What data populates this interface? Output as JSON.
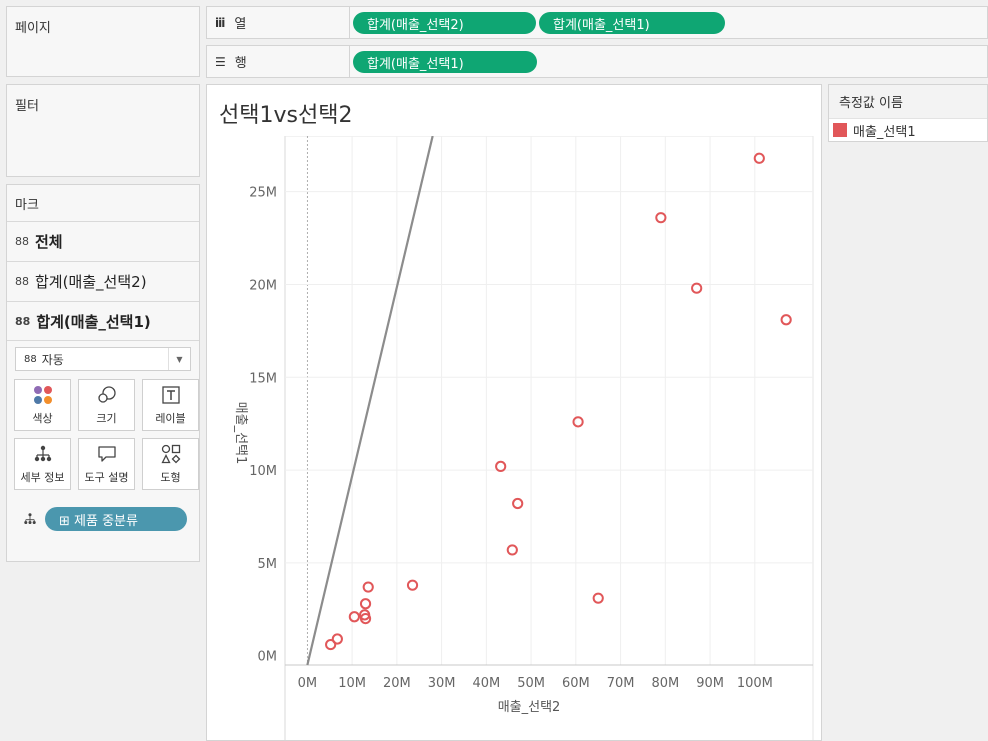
{
  "panels": {
    "pages_label": "페이지",
    "filters_label": "필터",
    "marks_label": "마크"
  },
  "shelves": {
    "columns": {
      "icon": "iii",
      "label": "열",
      "pills": [
        "합계(매출_선택2)",
        "합계(매출_선택1)"
      ]
    },
    "rows": {
      "icon": "☰",
      "label": "행",
      "pills": [
        "합계(매출_선택1)"
      ]
    }
  },
  "marks": {
    "cards": [
      {
        "label": "전체",
        "icon": "pill-group-icon"
      },
      {
        "label": "합계(매출_선택2)",
        "icon": "pill-group-icon"
      },
      {
        "label": "합계(매출_선택1)",
        "icon": "pill-group-icon"
      }
    ],
    "mark_type": "자동",
    "buttons": [
      {
        "label": "색상",
        "icon": "color-icon"
      },
      {
        "label": "크기",
        "icon": "size-icon"
      },
      {
        "label": "레이블",
        "icon": "label-icon"
      },
      {
        "label": "세부 정보",
        "icon": "detail-icon"
      },
      {
        "label": "도구 설명",
        "icon": "tooltip-icon"
      },
      {
        "label": "도형",
        "icon": "shape-icon"
      }
    ],
    "detail_pill": "⊞ 제품 중분류"
  },
  "legend": {
    "title": "측정값 이름",
    "items": [
      {
        "label": "매출_선택1",
        "color": "#e15759"
      }
    ]
  },
  "chart_data": {
    "type": "scatter",
    "title": "선택1vs선택2",
    "xlabel": "매출_선택2",
    "ylabel": "매출_선택1",
    "xlim": [
      -5,
      113
    ],
    "ylim": [
      -0.5,
      28
    ],
    "x_ticks": [
      0,
      10,
      20,
      30,
      40,
      50,
      60,
      70,
      80,
      90,
      100
    ],
    "x_tick_labels": [
      "0M",
      "10M",
      "20M",
      "30M",
      "40M",
      "50M",
      "60M",
      "70M",
      "80M",
      "90M",
      "100M"
    ],
    "y_ticks": [
      0,
      5,
      10,
      15,
      20,
      25
    ],
    "y_tick_labels": [
      "0M",
      "5M",
      "10M",
      "15M",
      "20M",
      "25M"
    ],
    "grid": true,
    "marker": "open-circle",
    "marker_color": "#e15759",
    "reference_line": {
      "type": "trend",
      "x": [
        0,
        28
      ],
      "y": [
        -0.5,
        28
      ]
    },
    "series": [
      {
        "name": "매출_선택1",
        "points": [
          [
            5.2,
            0.6
          ],
          [
            6.7,
            0.9
          ],
          [
            10.5,
            2.1
          ],
          [
            12.8,
            2.2
          ],
          [
            13.0,
            2.0
          ],
          [
            13.0,
            2.8
          ],
          [
            13.6,
            3.7
          ],
          [
            23.5,
            3.8
          ],
          [
            43.2,
            10.2
          ],
          [
            45.8,
            5.7
          ],
          [
            47.0,
            8.2
          ],
          [
            60.5,
            12.6
          ],
          [
            65.0,
            3.1
          ],
          [
            79.0,
            23.6
          ],
          [
            87.0,
            19.8
          ],
          [
            101.0,
            26.8
          ],
          [
            107.0,
            18.1
          ]
        ]
      }
    ]
  }
}
